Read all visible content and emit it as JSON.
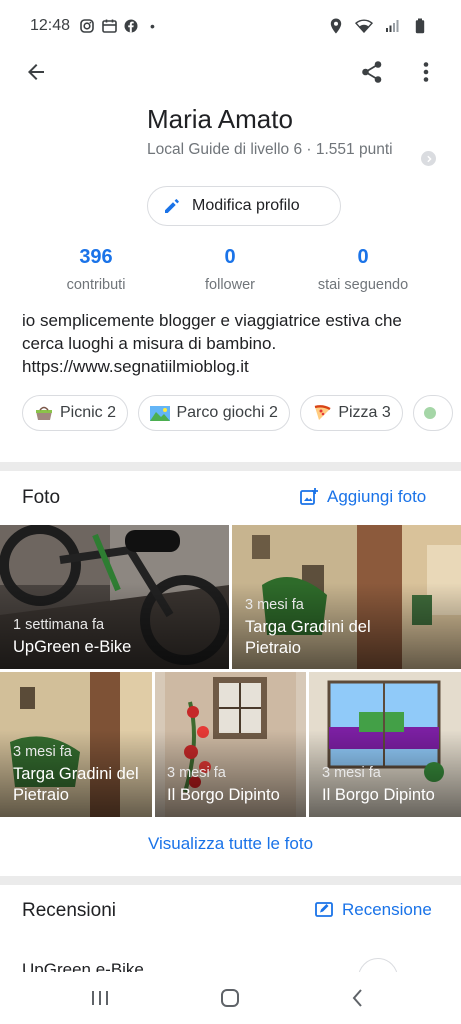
{
  "status_bar": {
    "time": "12:48",
    "dot": "•",
    "left_icons": [
      "instagram-icon",
      "calendar-icon",
      "facebook-icon"
    ],
    "right_icons": [
      "location-icon",
      "wifi-icon",
      "signal-icon",
      "battery-icon"
    ]
  },
  "appbar": {
    "icons": [
      "arrow-back-icon",
      "share-icon",
      "more-vert-icon"
    ]
  },
  "profile": {
    "name": "Maria Amato",
    "level": "Local Guide di livello 6 · 1.551 punti",
    "edit_label": "Modifica profilo"
  },
  "stats": [
    {
      "value": "396",
      "label": "contributi"
    },
    {
      "value": "0",
      "label": "follower"
    },
    {
      "value": "0",
      "label": "stai seguendo"
    }
  ],
  "bio": {
    "text": "io semplicemente blogger e viaggiatrice estiva che cerca luoghi a misura di bambino. https://www.segnatiilmioblog.it"
  },
  "chips": [
    {
      "label": "Picnic 2",
      "icon": "picnic-basket-icon"
    },
    {
      "label": "Parco giochi 2",
      "icon": "playground-icon"
    },
    {
      "label": "Pizza 3",
      "icon": "pizza-icon"
    }
  ],
  "photos_section": {
    "title": "Foto",
    "action": "Aggiungi foto",
    "see_all": "Visualizza tutte le foto",
    "items": [
      {
        "when": "1 settimana fa",
        "name": "UpGreen e-Bike"
      },
      {
        "when": "3 mesi fa",
        "name": "Targa Gradini del Pietraio"
      },
      {
        "when": "3 mesi fa",
        "name": "Targa Gradini del Pietraio"
      },
      {
        "when": "3 mesi fa",
        "name": "Il Borgo Dipinto"
      },
      {
        "when": "3 mesi fa",
        "name": "Il Borgo Dipinto"
      }
    ]
  },
  "reviews_section": {
    "title": "Recensioni",
    "action": "Recensione",
    "first_item": "UpGreen e-Bike"
  },
  "navbar": {
    "icons": [
      "recents-icon",
      "home-icon",
      "back-icon"
    ]
  },
  "colors": {
    "accent": "#1a73e8",
    "secondary_text": "#70757a",
    "divider": "#ebebeb"
  }
}
